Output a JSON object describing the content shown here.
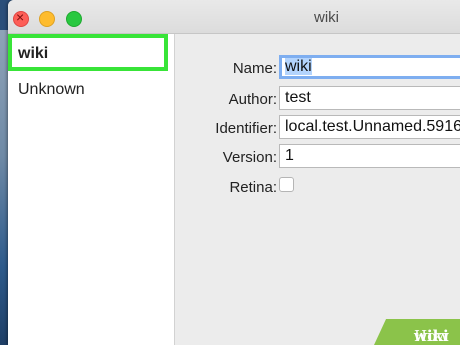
{
  "window": {
    "title": "wiki"
  },
  "sidebar": {
    "items": [
      {
        "label": "wiki",
        "selected": true
      },
      {
        "label": "Unknown",
        "selected": false
      }
    ],
    "selection_highlight_color": "#38e438"
  },
  "form": {
    "name_label": "Name:",
    "name_value": "wiki",
    "author_label": "Author:",
    "author_value": "test",
    "identifier_label": "Identifier:",
    "identifier_value": "local.test.Unnamed.5916",
    "version_label": "Version:",
    "version_value": "1",
    "retina_label": "Retina:",
    "retina_checked": false
  },
  "watermark": {
    "text_part1": "wiki",
    "text_part2": "How"
  },
  "colors": {
    "close": "#fd5e57",
    "minimize": "#febc2e",
    "maximize": "#29c840",
    "focus_ring": "#7eaef0",
    "text_selection": "#b3d4fd"
  }
}
